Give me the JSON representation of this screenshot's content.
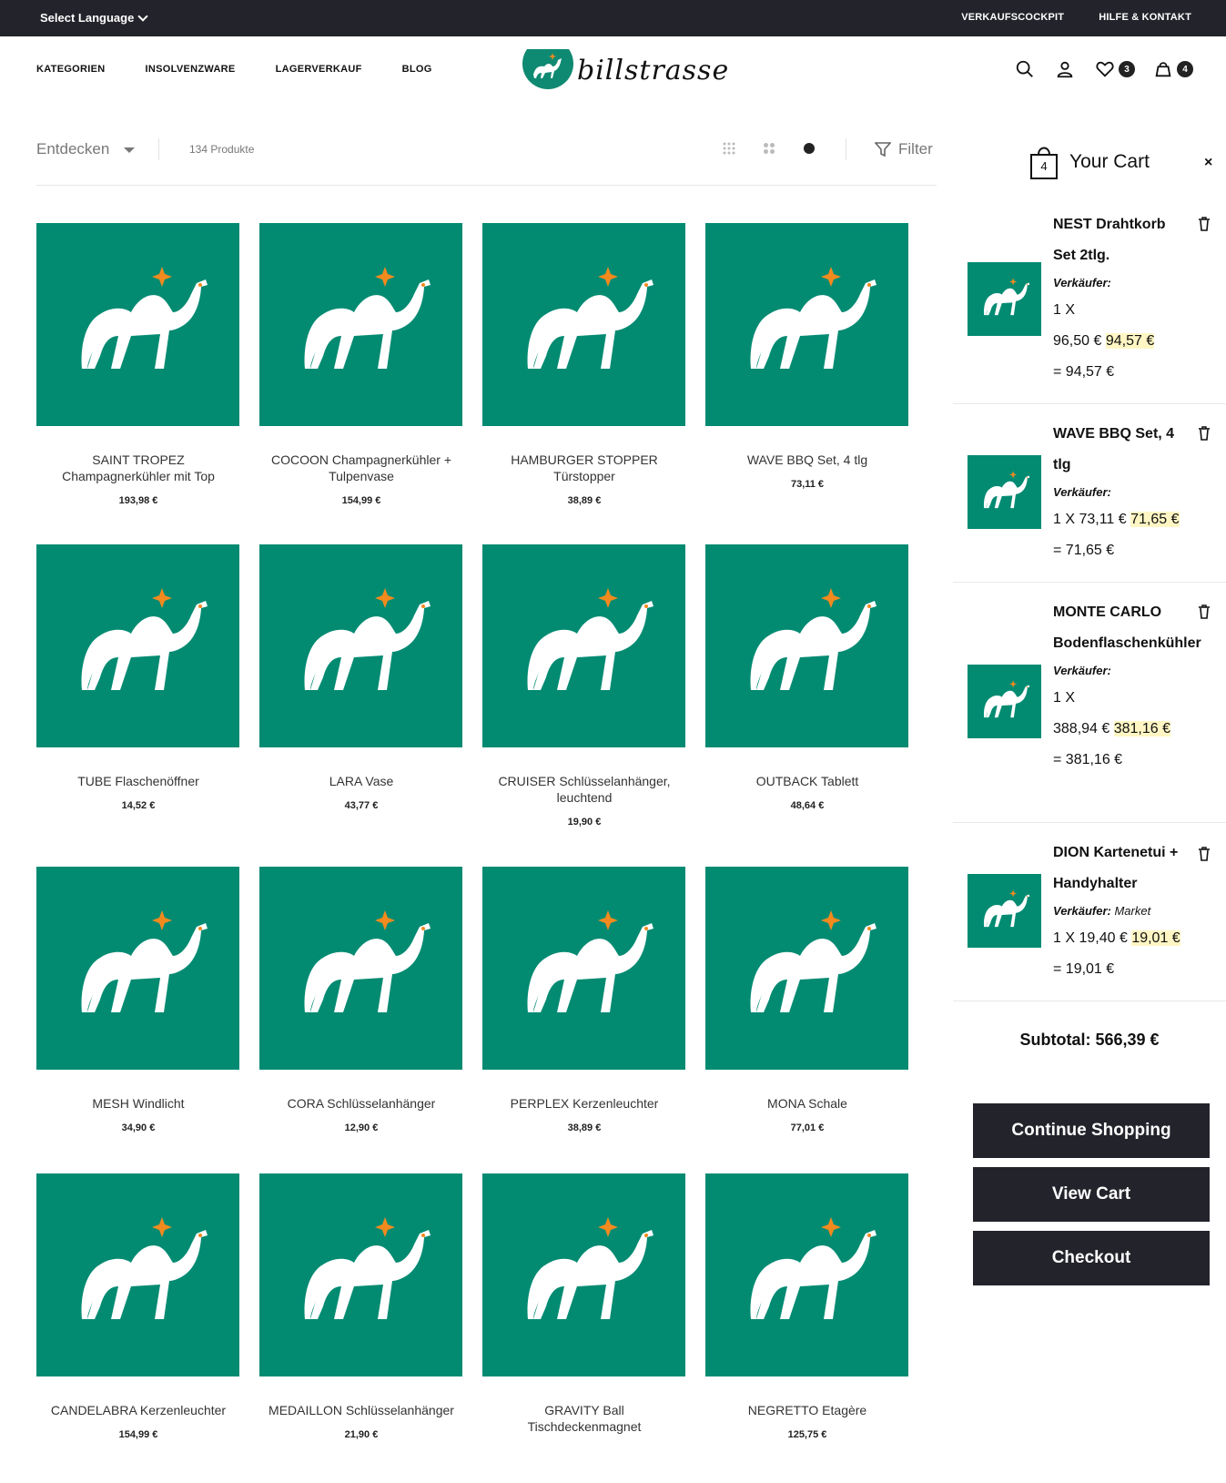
{
  "topbar": {
    "language": "Select Language",
    "links": [
      "VERKAUFSCOCKPIT",
      "HILFE & KONTAKT"
    ]
  },
  "header": {
    "nav": [
      "KATEGORIEN",
      "INSOLVENZWARE",
      "LAGERVERKAUF",
      "BLOG"
    ],
    "logo_text": "billstrasse",
    "wishlist_count": "3",
    "cart_count": "4"
  },
  "toolbar": {
    "discover": "Entdecken",
    "product_count": "134 Produkte",
    "filter": "Filter"
  },
  "products": [
    {
      "name": "SAINT TROPEZ Champagnerkühler mit Top",
      "price": "193,98 €"
    },
    {
      "name": "COCOON Champagnerkühler + Tulpenvase",
      "price": "154,99 €"
    },
    {
      "name": "HAMBURGER STOPPER Türstopper",
      "price": "38,89 €"
    },
    {
      "name": "WAVE BBQ Set, 4 tlg",
      "price": "73,11 €"
    },
    {
      "name": "TUBE Flaschenöffner",
      "price": "14,52 €"
    },
    {
      "name": "LARA Vase",
      "price": "43,77 €"
    },
    {
      "name": "CRUISER Schlüsselanhänger, leuchtend",
      "price": "19,90 €"
    },
    {
      "name": "OUTBACK Tablett",
      "price": "48,64 €"
    },
    {
      "name": "MESH Windlicht",
      "price": "34,90 €"
    },
    {
      "name": "CORA Schlüsselanhänger",
      "price": "12,90 €"
    },
    {
      "name": "PERPLEX Kerzenleuchter",
      "price": "38,89 €"
    },
    {
      "name": "MONA Schale",
      "price": "77,01 €"
    },
    {
      "name": "CANDELABRA Kerzenleuchter",
      "price": "154,99 €"
    },
    {
      "name": "MEDAILLON Schlüsselanhänger",
      "price": "21,90 €"
    },
    {
      "name": "GRAVITY Ball Tischdeckenmagnet",
      "price": ""
    },
    {
      "name": "NEGRETTO Etagère",
      "price": "125,75 €"
    }
  ],
  "cart": {
    "count": "4",
    "title": "Your Cart",
    "close": "×",
    "seller_label": "Verkäufer:",
    "items": [
      {
        "name": "NEST Drahtkorb Set 2tlg.",
        "seller": "",
        "qty": "1 X",
        "old_price": "96,50 €",
        "new_price": "94,57 €",
        "total": "= 94,57 €"
      },
      {
        "name": "WAVE BBQ Set, 4 tlg",
        "seller": "",
        "qty": "1 X",
        "old_price": "73,11 €",
        "new_price": "71,65 €",
        "total": "= 71,65 €"
      },
      {
        "name": "MONTE CARLO Bodenflaschenkühler",
        "seller": "",
        "qty": "1 X",
        "old_price": "388,94 €",
        "new_price": "381,16 €",
        "total": "= 381,16 €"
      },
      {
        "name": "DION Kartenetui + Handyhalter",
        "seller": "Market",
        "qty": "1 X",
        "old_price": "19,40 €",
        "new_price": "19,01 €",
        "total": "= 19,01 €"
      }
    ],
    "subtotal": "Subtotal: 566,39 €",
    "buttons": [
      "Continue Shopping",
      "View Cart",
      "Checkout"
    ]
  }
}
